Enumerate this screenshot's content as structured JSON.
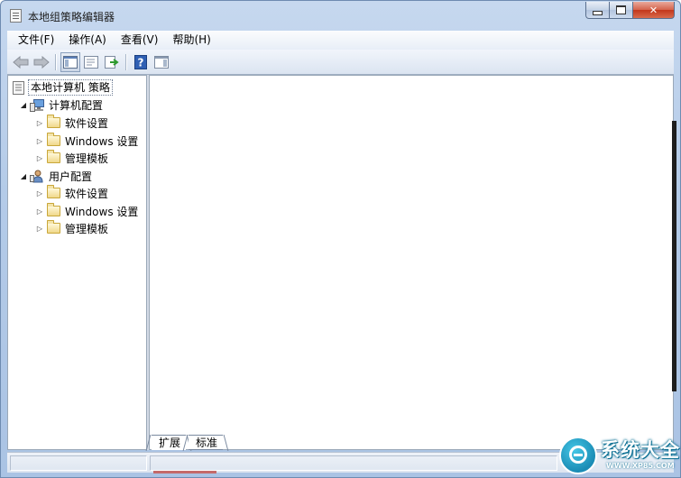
{
  "window": {
    "title": "本地组策略编辑器"
  },
  "menubar": {
    "items": [
      "文件(F)",
      "操作(A)",
      "查看(V)",
      "帮助(H)"
    ]
  },
  "toolbar": {
    "icons": [
      "back-arrow-icon",
      "forward-arrow-icon",
      "show-tree-icon",
      "properties-icon",
      "export-list-icon",
      "help-icon",
      "show-action-pane-icon"
    ]
  },
  "tree": {
    "root": "本地计算机 策略",
    "computer": {
      "label": "计算机配置",
      "children": [
        "软件设置",
        "Windows 设置",
        "管理模板"
      ]
    },
    "user": {
      "label": "用户配置",
      "children": [
        "软件设置",
        "Windows 设置",
        "管理模板"
      ]
    }
  },
  "tabs": [
    "扩展",
    "标准"
  ],
  "watermark": {
    "title": "系统大全",
    "url": "WWW.XP85.COM"
  },
  "colors": {
    "frame": "#b4cbe8",
    "close_button": "#c3371b",
    "watermark": "#1a8cb5"
  }
}
